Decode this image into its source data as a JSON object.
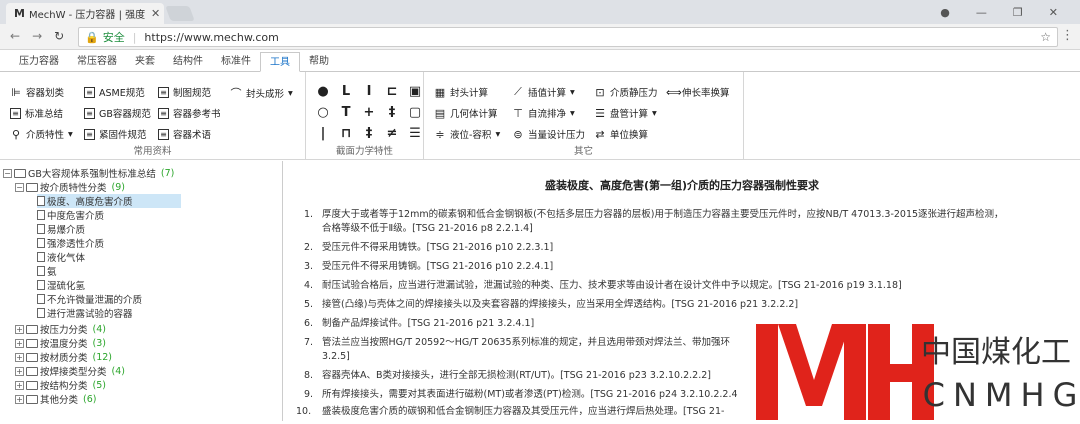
{
  "browser": {
    "tab_title": "MechW - 压力容器 | 强度",
    "tab_logo": "M",
    "secure_label": "安全",
    "url": "https://www.mechw.com"
  },
  "ribbon_tabs": [
    "压力容器",
    "常压容器",
    "夹套",
    "结构件",
    "标准件",
    "工具",
    "帮助"
  ],
  "active_tab": "工具",
  "ribbon": {
    "common": {
      "label": "常用资料",
      "items": [
        "容器划类",
        "ASME规范",
        "制图规范",
        "封头成形",
        "标准总结",
        "GB容器规范",
        "容器参考书",
        "介质特性",
        "紧固件规范",
        "容器术语"
      ]
    },
    "section": {
      "label": "截面力学特性"
    },
    "other": {
      "label": "其它",
      "items": [
        "封头计算",
        "插值计算",
        "介质静压力",
        "伸长率换算",
        "几何体计算",
        "自流排净",
        "盘管计算",
        "液位-容积",
        "当量设计压力",
        "单位换算"
      ]
    }
  },
  "tree": {
    "root": {
      "label": "GB大容规体系强制性标准总结",
      "count": "(7)"
    },
    "medium": {
      "label": "按介质特性分类",
      "count": "(9)"
    },
    "children": [
      "极度、高度危害介质",
      "中度危害介质",
      "易爆介质",
      "强渗透性介质",
      "液化气体",
      "氨",
      "湿硫化氢",
      "不允许微量泄漏的介质",
      "进行泄露试验的容器"
    ],
    "groups": [
      {
        "label": "按压力分类",
        "count": "(4)"
      },
      {
        "label": "按温度分类",
        "count": "(3)"
      },
      {
        "label": "按材质分类",
        "count": "(12)"
      },
      {
        "label": "按焊接类型分类",
        "count": "(4)"
      },
      {
        "label": "按结构分类",
        "count": "(5)"
      },
      {
        "label": "其他分类",
        "count": "(6)"
      }
    ]
  },
  "content": {
    "title": "盛装极度、高度危害(第一组)介质的压力容器强制性要求",
    "items": [
      "厚度大于或者等于12mm的碳素钢和低合金钢钢板(不包括多层压力容器的层板)用于制造压力容器主要受压元件时，应按NB/T 47013.3-2015逐张进行超声检测，",
      "合格等级不低于Ⅱ级。[TSG 21-2016 p8 2.2.1.4]",
      "受压元件不得采用铸铁。[TSG 21-2016 p10 2.2.3.1]",
      "受压元件不得采用铸钢。[TSG 21-2016 p10 2.2.4.1]",
      "耐压试验合格后，应当进行泄漏试验，泄漏试验的种类、压力、技术要求等由设计者在设计文件中予以规定。[TSG 21-2016 p19 3.1.18]",
      "接管(凸缘)与壳体之间的焊接接头以及夹套容器的焊接接头，应当采用全焊透结构。[TSG 21-2016 p21 3.2.2.2]",
      "制备产品焊接试件。[TSG 21-2016 p21 3.2.4.1]",
      "管法兰应当按照HG/T 20592～HG/T 20635系列标准的规定，并且选用带颈对焊法兰、带加强环",
      "3.2.5]",
      "容器壳体A、B类对接接头，进行全部无损检测(RT/UT)。[TSG 21-2016 p23 3.2.10.2.2.2]",
      "所有焊接接头，需要对其表面进行磁粉(MT)或者渗透(PT)检测。[TSG 21-2016 p24 3.2.10.2.2.4",
      "盛装极度危害介质的碳钢和低合金钢制压力容器及其受压元件，应当进行焊后热处理。[TSG 21-"
    ],
    "numbers": [
      "1.",
      "2.",
      "3.",
      "4.",
      "5.",
      "6.",
      "7.",
      "8.",
      "9.",
      "10."
    ]
  },
  "watermark": {
    "cn": "中国煤化工",
    "en": "CNMHG",
    "color": "#e0231b"
  }
}
